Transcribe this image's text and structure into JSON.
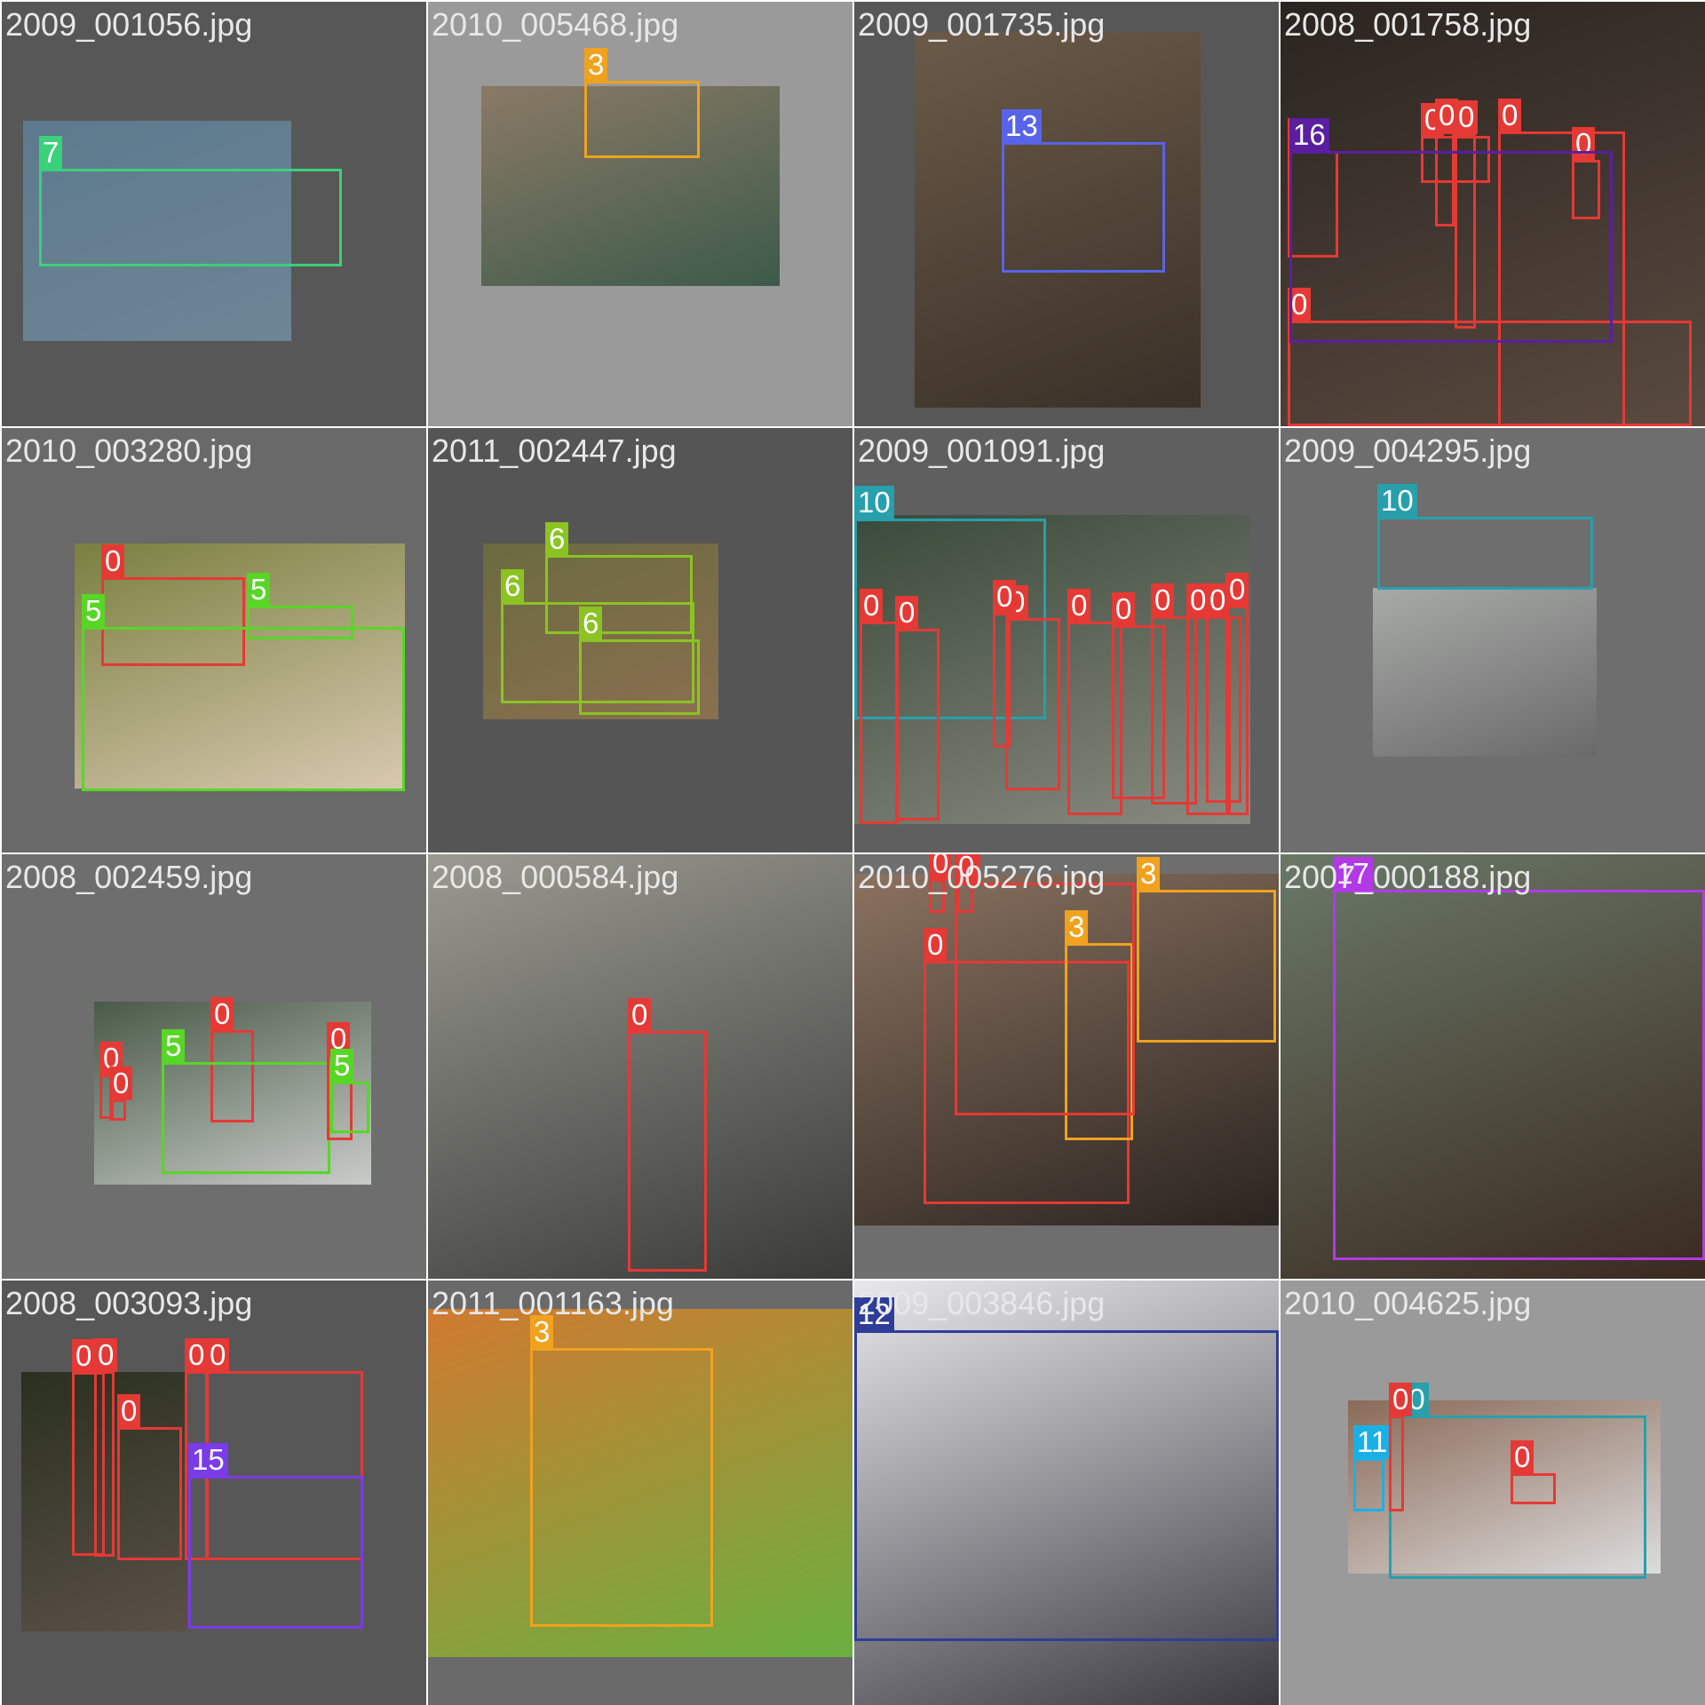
{
  "class_colors": {
    "0": "#e53935",
    "3": "#f0a21e",
    "5": "#58d626",
    "6": "#8bc322",
    "7": "#3bd07a",
    "10": "#27a0ab",
    "11": "#1ab0e6",
    "12": "#2e3d98",
    "13": "#5864e8",
    "15": "#7a3be8",
    "16": "#5a1fa0",
    "17": "#b23ae6"
  },
  "tiles": [
    {
      "filename": "2009_001056.jpg",
      "photo_colors": [
        "#5d7a8e",
        "#6e8595"
      ],
      "boxes": [
        {
          "label": "7"
        }
      ]
    },
    {
      "filename": "2010_005468.jpg",
      "photo_colors": [
        "#8a7a66",
        "#3d5a4a"
      ],
      "boxes": [
        {
          "label": "3"
        }
      ]
    },
    {
      "filename": "2009_001735.jpg",
      "photo_colors": [
        "#6b5a48",
        "#3a3028"
      ],
      "boxes": [
        {
          "label": "13"
        }
      ]
    },
    {
      "filename": "2008_001758.jpg",
      "photo_colors": [
        "#2a2420",
        "#5a4a40"
      ],
      "boxes": [
        {
          "label": "0"
        },
        {
          "label": "0"
        },
        {
          "label": "0"
        },
        {
          "label": "0"
        },
        {
          "label": "0"
        },
        {
          "label": "0"
        },
        {
          "label": "0"
        },
        {
          "label": "16"
        }
      ]
    },
    {
      "filename": "2010_003280.jpg",
      "photo_colors": [
        "#7a8040",
        "#d8c8b0"
      ],
      "boxes": [
        {
          "label": "0"
        },
        {
          "label": "5"
        },
        {
          "label": "5"
        }
      ]
    },
    {
      "filename": "2011_002447.jpg",
      "photo_colors": [
        "#6b6a40",
        "#8a7050"
      ],
      "boxes": [
        {
          "label": "6"
        },
        {
          "label": "6"
        },
        {
          "label": "6"
        }
      ]
    },
    {
      "filename": "2009_001091.jpg",
      "photo_colors": [
        "#3a4a3a",
        "#8a8a80"
      ],
      "boxes": [
        {
          "label": "10"
        },
        {
          "label": "0"
        },
        {
          "label": "0"
        },
        {
          "label": "0"
        },
        {
          "label": "0"
        },
        {
          "label": "0"
        },
        {
          "label": "0"
        },
        {
          "label": "0"
        },
        {
          "label": "0"
        },
        {
          "label": "0"
        },
        {
          "label": "0"
        }
      ]
    },
    {
      "filename": "2009_004295.jpg",
      "photo_colors": [
        "#a8aaa8",
        "#6a6a6a"
      ],
      "boxes": [
        {
          "label": "10"
        }
      ]
    },
    {
      "filename": "2008_002459.jpg",
      "photo_colors": [
        "#4a5a48",
        "#c8ccc8"
      ],
      "boxes": [
        {
          "label": "0"
        },
        {
          "label": "5"
        },
        {
          "label": "0"
        },
        {
          "label": "0"
        },
        {
          "label": "0"
        },
        {
          "label": "5"
        }
      ]
    },
    {
      "filename": "2008_000584.jpg",
      "photo_colors": [
        "#9a9a92",
        "#3a3a38"
      ],
      "boxes": [
        {
          "label": "0"
        }
      ]
    },
    {
      "filename": "2010_005276.jpg",
      "photo_colors": [
        "#8a7260",
        "#2a2420"
      ],
      "boxes": [
        {
          "label": "0"
        },
        {
          "label": "0"
        },
        {
          "label": "0"
        },
        {
          "label": "3"
        },
        {
          "label": "3"
        },
        {
          "label": "0"
        }
      ]
    },
    {
      "filename": "2007_000188.jpg",
      "photo_colors": [
        "#6a7868",
        "#3a2a20"
      ],
      "boxes": [
        {
          "label": "17"
        }
      ]
    },
    {
      "filename": "2008_003093.jpg",
      "photo_colors": [
        "#2a3020",
        "#5a5048"
      ],
      "boxes": [
        {
          "label": "0"
        },
        {
          "label": "0"
        },
        {
          "label": "0"
        },
        {
          "label": "0"
        },
        {
          "label": "0"
        },
        {
          "label": "15"
        }
      ]
    },
    {
      "filename": "2011_001163.jpg",
      "photo_colors": [
        "#d07a30",
        "#6ab040"
      ],
      "boxes": [
        {
          "label": "3"
        }
      ]
    },
    {
      "filename": "2009_003846.jpg",
      "photo_colors": [
        "#e8e8ec",
        "#3a3a40"
      ],
      "boxes": [
        {
          "label": "12"
        }
      ]
    },
    {
      "filename": "2010_004625.jpg",
      "photo_colors": [
        "#8a6a58",
        "#dcdcdc"
      ],
      "boxes": [
        {
          "label": "10"
        },
        {
          "label": "11"
        },
        {
          "label": "0"
        },
        {
          "label": "0"
        }
      ]
    }
  ]
}
